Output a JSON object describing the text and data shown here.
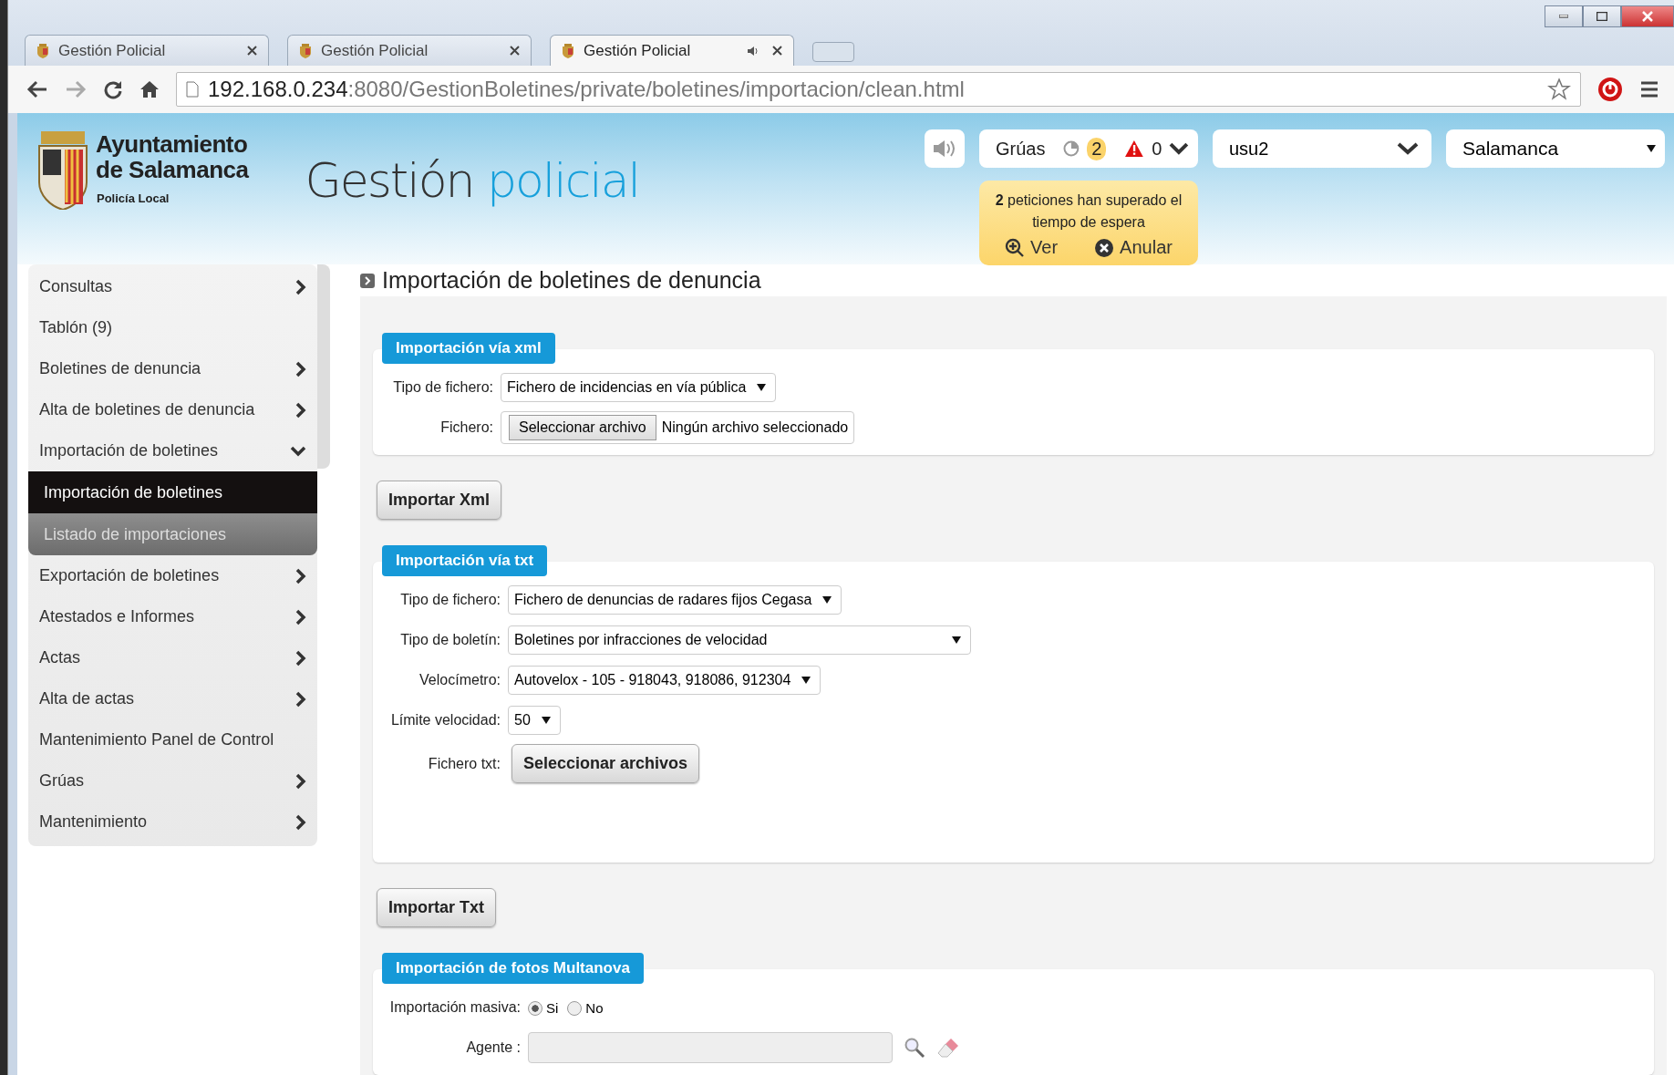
{
  "browser": {
    "tabs": [
      {
        "title": "Gestión Policial",
        "selected": false,
        "audio": false
      },
      {
        "title": "Gestión Policial",
        "selected": false,
        "audio": false
      },
      {
        "title": "Gestión Policial",
        "selected": true,
        "audio": true
      }
    ],
    "url_host": "192.168.0.234",
    "url_rest": ":8080/GestionBoletines/private/boletines/importacion/clean.html"
  },
  "header": {
    "logo_lines": [
      "Ayuntamiento",
      "de Salamanca"
    ],
    "logo_subtitle": "Policía Local",
    "app_title": "Gestión",
    "app_title_accent": "policial",
    "gruas": {
      "label": "Grúas",
      "pending": "2",
      "alerts": "0"
    },
    "user": "usu2",
    "city": "Salamanca",
    "notice": {
      "text": "**2** peticiones han superado el tiempo de espera",
      "actions": [
        "Ver",
        "Anular"
      ]
    }
  },
  "sidebar": {
    "items": [
      {
        "label": "Consultas",
        "kind": "menu",
        "expanded": false
      },
      {
        "label": "Tablón (9)",
        "kind": "link"
      },
      {
        "label": "Boletines de denuncia",
        "kind": "menu",
        "expanded": false
      },
      {
        "label": "Alta de boletines de denuncia",
        "kind": "menu",
        "expanded": false
      },
      {
        "label": "Importación de boletines",
        "kind": "menu",
        "expanded": true,
        "children": [
          {
            "label": "Importación de boletines",
            "selected": true
          },
          {
            "label": "Listado de importaciones",
            "selected": false
          }
        ]
      },
      {
        "label": "Exportación de boletines",
        "kind": "menu",
        "expanded": false
      },
      {
        "label": "Atestados e Informes",
        "kind": "menu",
        "expanded": false
      },
      {
        "label": "Actas",
        "kind": "menu",
        "expanded": false
      },
      {
        "label": "Alta de actas",
        "kind": "menu",
        "expanded": false
      },
      {
        "label": "Mantenimiento Panel de Control",
        "kind": "link"
      },
      {
        "label": "Grúas",
        "kind": "menu",
        "expanded": false
      },
      {
        "label": "Mantenimiento",
        "kind": "menu",
        "expanded": false
      }
    ]
  },
  "page_title": "Importación de boletines de denuncia",
  "sections": [
    {
      "title": "Importación vía xml",
      "fields": [
        {
          "label": "Tipo de fichero:",
          "kind": "select",
          "value": "Fichero de incidencias en vía pública",
          "wide": false
        },
        {
          "label": "Fichero:",
          "kind": "file",
          "button": "Seleccionar archivo",
          "value": "Ningún archivo seleccionado"
        }
      ],
      "button": "Importar Xml"
    },
    {
      "title": "Importación vía txt",
      "fields": [
        {
          "label": "Tipo de fichero:",
          "kind": "select",
          "value": "Fichero de denuncias de radares fijos Cegasa",
          "wide": false
        },
        {
          "label": "Tipo de boletín:",
          "kind": "select",
          "value": "Boletines por infracciones de velocidad",
          "wide": true
        },
        {
          "label": "Velocímetro:",
          "kind": "select",
          "value": "Autovelox - 105 - 918043, 918086, 912304",
          "wide": false
        },
        {
          "label": "Límite velocidad:",
          "kind": "select",
          "value": "50",
          "wide": false
        },
        {
          "label": "Fichero txt:",
          "kind": "files",
          "button": "Seleccionar archivos"
        }
      ],
      "button": "Importar Txt"
    },
    {
      "title": "Importación de fotos Multanova",
      "fields": [
        {
          "label": "Importación masiva:",
          "kind": "radio",
          "options": [
            {
              "label": "Si",
              "selected": true
            },
            {
              "label": "No",
              "selected": false
            }
          ]
        },
        {
          "label": "Agente :",
          "kind": "lookup"
        }
      ]
    }
  ]
}
